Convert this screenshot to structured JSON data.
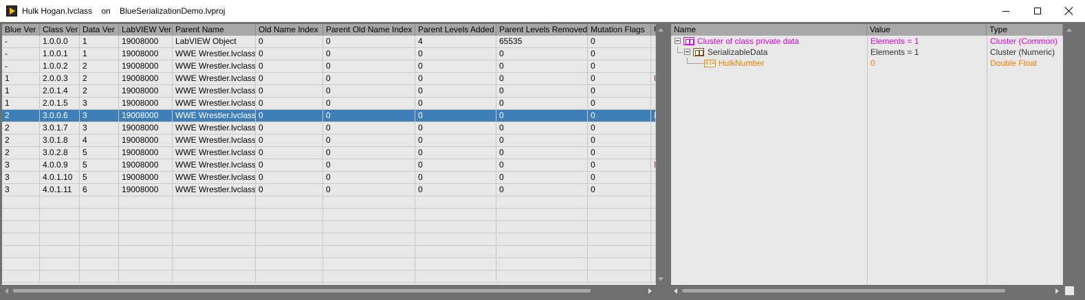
{
  "window": {
    "title": "Hulk Hogan.lvclass    on    BlueSerializationDemo.lvproj"
  },
  "left_table": {
    "columns": [
      "Blue Ver",
      "Class Ver",
      "Data Ver",
      "LabVIEW Ver",
      "Parent Name",
      "Old Name Index",
      "Parent Old Name Index",
      "Parent Levels Added",
      "Parent Levels Removed",
      "Mutation Flags",
      "U"
    ],
    "selected_row": 6,
    "rows": [
      [
        "-",
        "1.0.0.0",
        "1",
        "19008000",
        "LabVIEW Object",
        "0",
        "0",
        "4",
        "65535",
        "0",
        ""
      ],
      [
        "-",
        "1.0.0.1",
        "1",
        "19008000",
        "WWE Wrestler.lvclass",
        "0",
        "0",
        "0",
        "0",
        "0",
        ""
      ],
      [
        "-",
        "1.0.0.2",
        "2",
        "19008000",
        "WWE Wrestler.lvclass",
        "0",
        "0",
        "0",
        "0",
        "0",
        ""
      ],
      [
        "1",
        "2.0.0.3",
        "2",
        "19008000",
        "WWE Wrestler.lvclass",
        "0",
        "0",
        "0",
        "0",
        "0",
        "I"
      ],
      [
        "1",
        "2.0.1.4",
        "2",
        "19008000",
        "WWE Wrestler.lvclass",
        "0",
        "0",
        "0",
        "0",
        "0",
        ""
      ],
      [
        "1",
        "2.0.1.5",
        "3",
        "19008000",
        "WWE Wrestler.lvclass",
        "0",
        "0",
        "0",
        "0",
        "0",
        ""
      ],
      [
        "2",
        "3.0.0.6",
        "3",
        "19008000",
        "WWE Wrestler.lvclass",
        "0",
        "0",
        "0",
        "0",
        "0",
        "I"
      ],
      [
        "2",
        "3.0.1.7",
        "3",
        "19008000",
        "WWE Wrestler.lvclass",
        "0",
        "0",
        "0",
        "0",
        "0",
        ""
      ],
      [
        "2",
        "3.0.1.8",
        "4",
        "19008000",
        "WWE Wrestler.lvclass",
        "0",
        "0",
        "0",
        "0",
        "0",
        ""
      ],
      [
        "2",
        "3.0.2.8",
        "5",
        "19008000",
        "WWE Wrestler.lvclass",
        "0",
        "0",
        "0",
        "0",
        "0",
        ""
      ],
      [
        "3",
        "4.0.0.9",
        "5",
        "19008000",
        "WWE Wrestler.lvclass",
        "0",
        "0",
        "0",
        "0",
        "0",
        "I"
      ],
      [
        "3",
        "4.0.1.10",
        "5",
        "19008000",
        "WWE Wrestler.lvclass",
        "0",
        "0",
        "0",
        "0",
        "0",
        ""
      ],
      [
        "3",
        "4.0.1.11",
        "6",
        "19008000",
        "WWE Wrestler.lvclass",
        "0",
        "0",
        "0",
        "0",
        "0",
        ""
      ]
    ],
    "empty_rows": 7
  },
  "right_tree": {
    "columns": [
      "Name",
      "Value",
      "Type"
    ],
    "nodes": [
      {
        "name": "Cluster of class private data",
        "value": "Elements = 1",
        "type": "Cluster (Common)",
        "icon": "cluster-icon",
        "color": "#e000d8"
      },
      {
        "name": "SerializableData",
        "value": "Elements = 1",
        "type": "Cluster (Numeric)",
        "icon": "numeric-cluster-icon",
        "color": "#303030"
      },
      {
        "name": "HulkNumber",
        "value": "0",
        "type": "Double Float",
        "icon": "double-icon",
        "icon_label": "3.14",
        "color": "#f08000"
      }
    ]
  }
}
